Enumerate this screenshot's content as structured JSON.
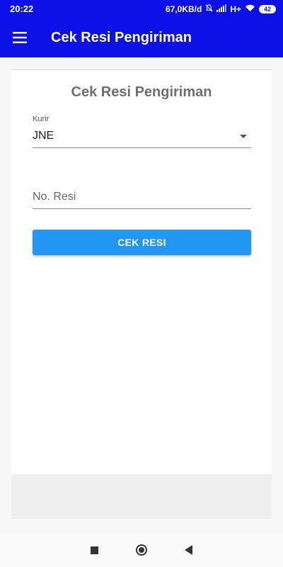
{
  "status_bar": {
    "time": "20:22",
    "network_speed": "67,0KB/d",
    "mute_icon": "bell-off-icon",
    "signal_icon": "signal-icon",
    "network_type": "H+",
    "wifi_icon": "wifi-icon",
    "battery_level": "42"
  },
  "app_bar": {
    "menu_icon": "hamburger-menu-icon",
    "title": "Cek Resi Pengiriman",
    "color": "#0b10e6"
  },
  "form": {
    "title": "Cek Resi Pengiriman",
    "courier_label": "Kurir",
    "courier_value": "JNE",
    "resi_placeholder": "No. Resi",
    "resi_value": "",
    "button_label": "CEK RESI",
    "button_color": "#2196f3"
  },
  "nav_bar": {
    "recents_icon": "square-icon",
    "home_icon": "circle-icon",
    "back_icon": "triangle-back-icon"
  }
}
